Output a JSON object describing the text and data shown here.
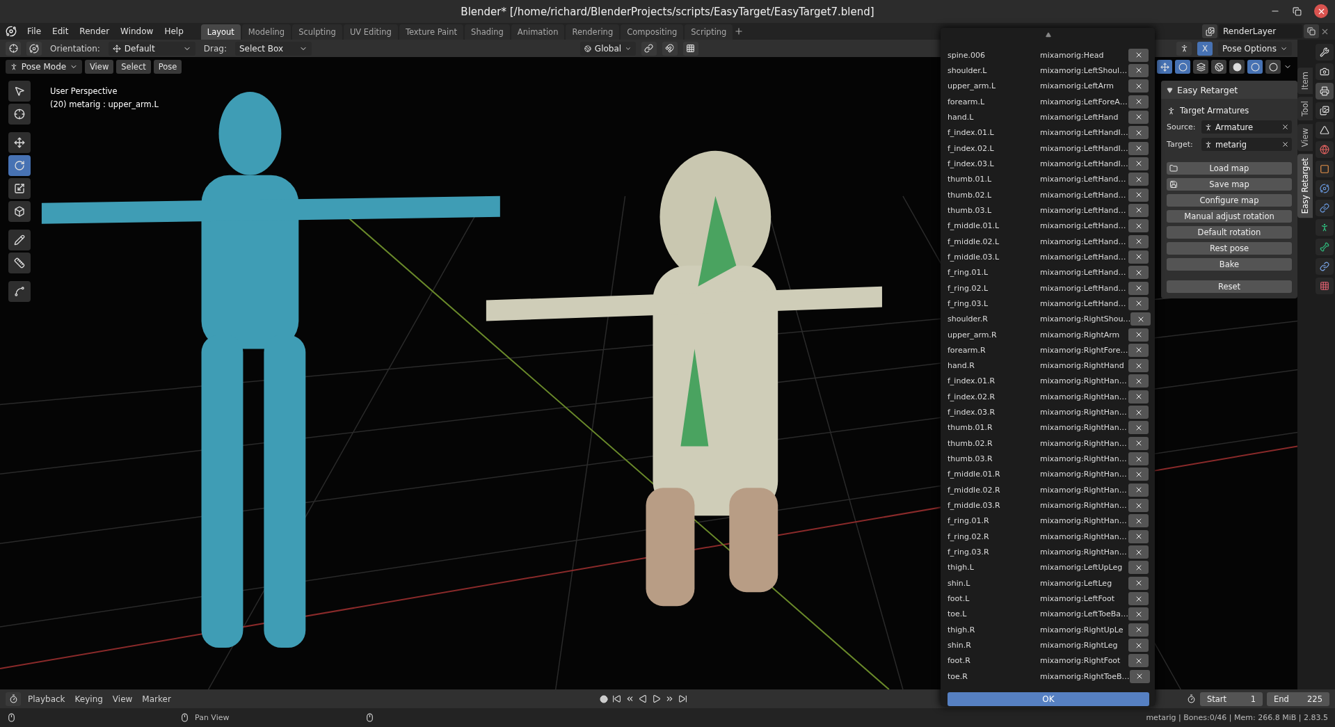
{
  "window": {
    "title": "Blender* [/home/richard/BlenderProjects/scripts/EasyTarget/EasyTarget7.blend]"
  },
  "menu": [
    "File",
    "Edit",
    "Render",
    "Window",
    "Help"
  ],
  "workspaces": [
    {
      "label": "Layout",
      "selected": true
    },
    {
      "label": "Modeling",
      "selected": false
    },
    {
      "label": "Sculpting",
      "selected": false
    },
    {
      "label": "UV Editing",
      "selected": false
    },
    {
      "label": "Texture Paint",
      "selected": false
    },
    {
      "label": "Shading",
      "selected": false
    },
    {
      "label": "Animation",
      "selected": false
    },
    {
      "label": "Rendering",
      "selected": false
    },
    {
      "label": "Compositing",
      "selected": false
    },
    {
      "label": "Scripting",
      "selected": false
    }
  ],
  "view_layer": "RenderLayer",
  "tool_header": {
    "orientation_label": "Orientation:",
    "orientation": "Default",
    "drag_label": "Drag:",
    "drag": "Select Box",
    "transform_orientation": "Global",
    "x_mirror": {
      "label": "X",
      "on": true
    },
    "pose_options": "Pose Options"
  },
  "viewport": {
    "mode": "Pose Mode",
    "menus": [
      "View",
      "Select",
      "Pose"
    ],
    "view_name": "User Perspective",
    "active": "(20) metarig : upper_arm.L",
    "tools": [
      {
        "kind": "select",
        "selected": false
      },
      {
        "kind": "cursor",
        "selected": false
      },
      {
        "kind": "move",
        "selected": false
      },
      {
        "kind": "rotate",
        "selected": true
      },
      {
        "kind": "scale",
        "selected": false
      },
      {
        "kind": "transform",
        "selected": false
      },
      {
        "kind": "annotate",
        "selected": false
      },
      {
        "kind": "measure",
        "selected": false
      },
      {
        "kind": "roll",
        "selected": false
      }
    ],
    "shading": [
      {
        "kind": "wireframe",
        "selected": false
      },
      {
        "kind": "solid",
        "selected": false
      },
      {
        "kind": "material",
        "selected": true
      },
      {
        "kind": "rendered",
        "selected": false
      }
    ]
  },
  "sidebar": {
    "tabs": [
      {
        "label": "Item",
        "selected": false
      },
      {
        "label": "Tool",
        "selected": false
      },
      {
        "label": "View",
        "selected": false
      },
      {
        "label": "Easy Retarget",
        "selected": true
      }
    ],
    "panel": {
      "title": "Easy Retarget",
      "expanded": true,
      "section": "Target Armatures",
      "fields": [
        {
          "label": "Source:",
          "value": "Armature"
        },
        {
          "label": "Target:",
          "value": "metarig"
        }
      ],
      "buttons": [
        {
          "label": "Load map",
          "kind": "folder"
        },
        {
          "label": "Save map",
          "kind": "export"
        },
        {
          "label": "Configure map",
          "kind": "plain"
        },
        {
          "label": "Manual adjust rotation",
          "kind": "plain"
        },
        {
          "label": "Default rotation",
          "kind": "plain"
        },
        {
          "label": "Rest pose",
          "kind": "plain"
        },
        {
          "label": "Bake",
          "kind": "plain"
        },
        {
          "label": "Reset",
          "kind": "spaced"
        }
      ]
    }
  },
  "properties_tabs": [
    {
      "kind": "tool",
      "selected": false
    },
    {
      "kind": "render",
      "selected": false
    },
    {
      "kind": "output",
      "selected": true
    },
    {
      "kind": "view_layer",
      "selected": false
    },
    {
      "kind": "scene",
      "selected": false
    },
    {
      "kind": "world",
      "selected": false
    },
    {
      "kind": "object",
      "selected": false
    },
    {
      "kind": "physics",
      "selected": false
    },
    {
      "kind": "constraints",
      "selected": false
    },
    {
      "kind": "armature",
      "selected": false
    },
    {
      "kind": "bone",
      "selected": false
    },
    {
      "kind": "bone_constraints",
      "selected": false
    },
    {
      "kind": "texture",
      "selected": false
    }
  ],
  "bone_map": {
    "rows": [
      {
        "bone": "spine.006",
        "target": "mixamorig:Head"
      },
      {
        "bone": "shoulder.L",
        "target": "mixamorig:LeftShoul…"
      },
      {
        "bone": "upper_arm.L",
        "target": "mixamorig:LeftArm"
      },
      {
        "bone": "forearm.L",
        "target": "mixamorig:LeftForeA…"
      },
      {
        "bone": "hand.L",
        "target": "mixamorig:LeftHand"
      },
      {
        "bone": "f_index.01.L",
        "target": "mixamorig:LeftHandI…"
      },
      {
        "bone": "f_index.02.L",
        "target": "mixamorig:LeftHandI…"
      },
      {
        "bone": "f_index.03.L",
        "target": "mixamorig:LeftHandI…"
      },
      {
        "bone": "thumb.01.L",
        "target": "mixamorig:LeftHand…"
      },
      {
        "bone": "thumb.02.L",
        "target": "mixamorig:LeftHand…"
      },
      {
        "bone": "thumb.03.L",
        "target": "mixamorig:LeftHand…"
      },
      {
        "bone": "f_middle.01.L",
        "target": "mixamorig:LeftHand…"
      },
      {
        "bone": "f_middle.02.L",
        "target": "mixamorig:LeftHand…"
      },
      {
        "bone": "f_middle.03.L",
        "target": "mixamorig:LeftHand…"
      },
      {
        "bone": "f_ring.01.L",
        "target": "mixamorig:LeftHand…"
      },
      {
        "bone": "f_ring.02.L",
        "target": "mixamorig:LeftHand…"
      },
      {
        "bone": "f_ring.03.L",
        "target": "mixamorig:LeftHand…"
      },
      {
        "bone": "shoulder.R",
        "target": "mixamorig:RightShou…"
      },
      {
        "bone": "upper_arm.R",
        "target": "mixamorig:RightArm"
      },
      {
        "bone": "forearm.R",
        "target": "mixamorig:RightFore…"
      },
      {
        "bone": "hand.R",
        "target": "mixamorig:RightHand"
      },
      {
        "bone": "f_index.01.R",
        "target": "mixamorig:RightHan…"
      },
      {
        "bone": "f_index.02.R",
        "target": "mixamorig:RightHan…"
      },
      {
        "bone": "f_index.03.R",
        "target": "mixamorig:RightHan…"
      },
      {
        "bone": "thumb.01.R",
        "target": "mixamorig:RightHan…"
      },
      {
        "bone": "thumb.02.R",
        "target": "mixamorig:RightHan…"
      },
      {
        "bone": "thumb.03.R",
        "target": "mixamorig:RightHan…"
      },
      {
        "bone": "f_middle.01.R",
        "target": "mixamorig:RightHan…"
      },
      {
        "bone": "f_middle.02.R",
        "target": "mixamorig:RightHan…"
      },
      {
        "bone": "f_middle.03.R",
        "target": "mixamorig:RightHan…"
      },
      {
        "bone": "f_ring.01.R",
        "target": "mixamorig:RightHan…"
      },
      {
        "bone": "f_ring.02.R",
        "target": "mixamorig:RightHan…"
      },
      {
        "bone": "f_ring.03.R",
        "target": "mixamorig:RightHan…"
      },
      {
        "bone": "thigh.L",
        "target": "mixamorig:LeftUpLeg"
      },
      {
        "bone": "shin.L",
        "target": "mixamorig:LeftLeg"
      },
      {
        "bone": "foot.L",
        "target": "mixamorig:LeftFoot"
      },
      {
        "bone": "toe.L",
        "target": "mixamorig:LeftToeBa…"
      },
      {
        "bone": "thigh.R",
        "target": "mixamorig:RightUpLe"
      },
      {
        "bone": "shin.R",
        "target": "mixamorig:RightLeg"
      },
      {
        "bone": "foot.R",
        "target": "mixamorig:RightFoot"
      },
      {
        "bone": "toe.R",
        "target": "mixamorig:RightToeB…"
      }
    ],
    "ok": "OK"
  },
  "timeline": {
    "menus": [
      "Playback",
      "Keying",
      "View",
      "Marker"
    ],
    "start_label": "Start",
    "start": "1",
    "end_label": "End",
    "end": "225"
  },
  "status_bar": {
    "hint": "Pan View",
    "info": "metarig | Bones:0/46 | Mem: 266.8 MiB | 2.83.5"
  }
}
